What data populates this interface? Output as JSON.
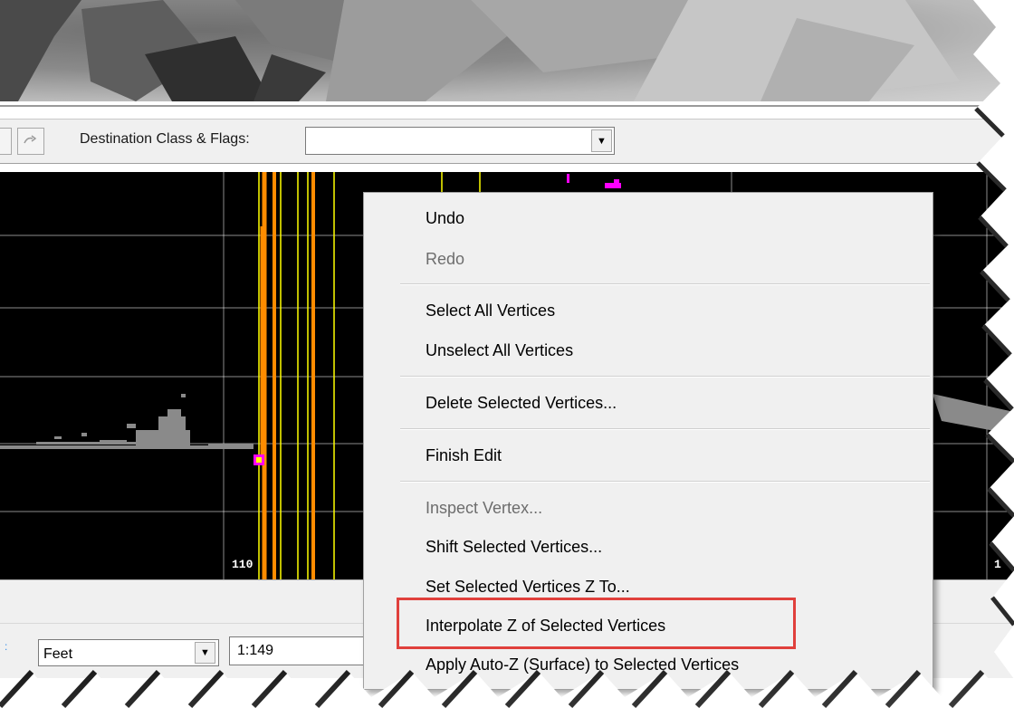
{
  "toolbar": {
    "destination_label": "Destination Class & Flags:",
    "destination_value": "",
    "redo_icon": "redo-icon",
    "combo_arrow": "▼"
  },
  "profile": {
    "axis_labels": [
      "110",
      "1"
    ],
    "colors": {
      "background": "#000000",
      "grid": "#ffffff",
      "yellow_lines": "#ffff00",
      "orange_lines": "#ff8c00",
      "vertex": "#ff00ff",
      "points": "#8a8a8a"
    }
  },
  "status": {
    "units": "Feet",
    "scale": "1:149"
  },
  "context_menu": {
    "items": [
      {
        "label": "Undo",
        "enabled": true
      },
      {
        "label": "Redo",
        "enabled": false
      },
      {
        "label": "Select All Vertices",
        "enabled": true
      },
      {
        "label": "Unselect All Vertices",
        "enabled": true
      },
      {
        "label": "Delete Selected Vertices...",
        "enabled": true
      },
      {
        "label": "Finish Edit",
        "enabled": true
      },
      {
        "label": "Inspect Vertex...",
        "enabled": false
      },
      {
        "label": "Shift Selected Vertices...",
        "enabled": true
      },
      {
        "label": "Set Selected Vertices Z To...",
        "enabled": true
      },
      {
        "label": "Interpolate Z of Selected Vertices",
        "enabled": true,
        "highlighted": true
      },
      {
        "label": "Apply Auto-Z (Surface) to Selected Vertices",
        "enabled": true
      }
    ],
    "highlight_color": "#e0403c"
  }
}
